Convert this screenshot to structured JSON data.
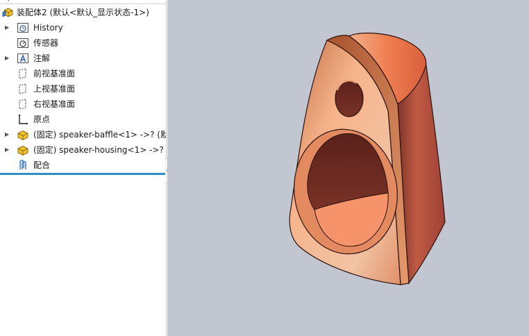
{
  "tree": {
    "filter_icon": "filter-icon",
    "assembly": {
      "label": "装配体2  (默认<默认_显示状态-1>)",
      "icon": "assembly-icon"
    },
    "items": [
      {
        "label": "History",
        "icon": "history-folder-icon",
        "expandable": true
      },
      {
        "label": "传感器",
        "icon": "sensor-folder-icon",
        "expandable": false
      },
      {
        "label": "注解",
        "icon": "annotation-folder-icon",
        "expandable": true
      },
      {
        "label": "前视基准面",
        "icon": "plane-icon",
        "expandable": false
      },
      {
        "label": "上视基准面",
        "icon": "plane-icon",
        "expandable": false
      },
      {
        "label": "右视基准面",
        "icon": "plane-icon",
        "expandable": false
      },
      {
        "label": "原点",
        "icon": "origin-icon",
        "expandable": false
      },
      {
        "label": "(固定) speaker-baffle<1> ->? (默",
        "icon": "part-icon",
        "expandable": true
      },
      {
        "label": "(固定) speaker-housing<1> ->? (",
        "icon": "part-icon",
        "expandable": true
      },
      {
        "label": "配合",
        "icon": "mates-icon",
        "expandable": false
      }
    ]
  },
  "colors": {
    "viewport_bg": "#c1c6d0",
    "rollback_bar": "#2f8fc3",
    "part_front": "#f0a57a",
    "part_side": "#b8564a",
    "part_top": "#e8784c"
  },
  "viewport": {
    "content": "speaker-model"
  }
}
